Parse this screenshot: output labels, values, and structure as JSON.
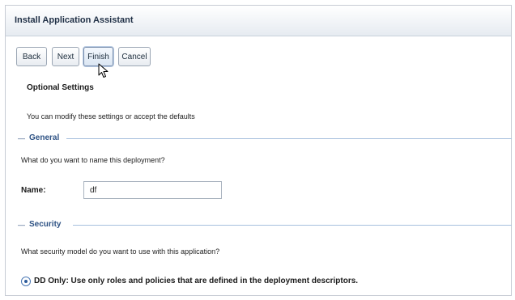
{
  "window": {
    "title": "Install Application Assistant"
  },
  "toolbar": {
    "back_label": "Back",
    "next_label": "Next",
    "finish_label": "Finish",
    "cancel_label": "Cancel"
  },
  "optional_settings": {
    "heading": "Optional Settings",
    "description": "You can modify these settings or accept the defaults"
  },
  "general": {
    "section_title": "General",
    "question": "What do you want to name this deployment?",
    "name_label": "Name:",
    "name_value": "df"
  },
  "security": {
    "section_title": "Security",
    "question": "What security model do you want to use with this application?",
    "option_dd_only": "DD Only: Use only roles and policies that are defined in the deployment descriptors."
  },
  "colors": {
    "accent": "#2e5284",
    "section_line": "#a7c0dd",
    "title_bar": "#e6ebf1"
  },
  "icons": {
    "cursor": "mouse-pointer-icon",
    "radio": "radio-selected-icon"
  }
}
